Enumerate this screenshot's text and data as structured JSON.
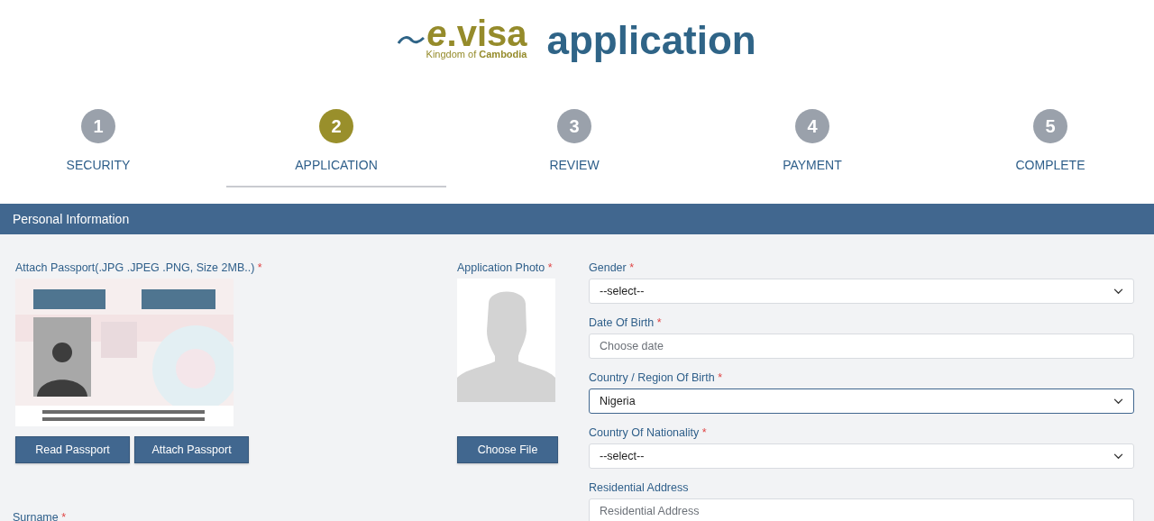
{
  "logo": {
    "brand": "*e*.visa",
    "tagline": "Kingdom of **Cambodia**",
    "heading": "application"
  },
  "steps": [
    {
      "number": "1",
      "label": "SECURITY",
      "selected": false
    },
    {
      "number": "2",
      "label": "APPLICATION",
      "selected": true
    },
    {
      "number": "3",
      "label": "REVIEW",
      "selected": false
    },
    {
      "number": "4",
      "label": "PAYMENT",
      "selected": false
    },
    {
      "number": "5",
      "label": "COMPLETE",
      "selected": false
    }
  ],
  "section": {
    "title": "Personal Information"
  },
  "passport": {
    "label": "Attach Passport(.JPG .JPEG .PNG, Size 2MB..)",
    "mark": "*",
    "buttons": [
      "Read Passport",
      "Attach Passport"
    ]
  },
  "photo": {
    "label": "Application Photo",
    "mark": "*",
    "button": "Choose File"
  },
  "fields": [
    {
      "label": "Gender",
      "mark": "*",
      "kind": "select",
      "value": "--select--",
      "focused": false
    },
    {
      "label": "Date Of Birth",
      "mark": "*",
      "kind": "input",
      "placeholder": "Choose date",
      "focused": false
    },
    {
      "label": "Country / Region Of Birth",
      "mark": "*",
      "kind": "select",
      "value": "Nigeria",
      "focused": true
    },
    {
      "label": "Country Of Nationality",
      "mark": "*",
      "kind": "select",
      "value": "--select--",
      "focused": false
    },
    {
      "label": "Residential Address",
      "kind": "input",
      "placeholder": "Residential Address",
      "focused": false
    }
  ],
  "surname": {
    "label": "Surname",
    "mark": "*"
  }
}
